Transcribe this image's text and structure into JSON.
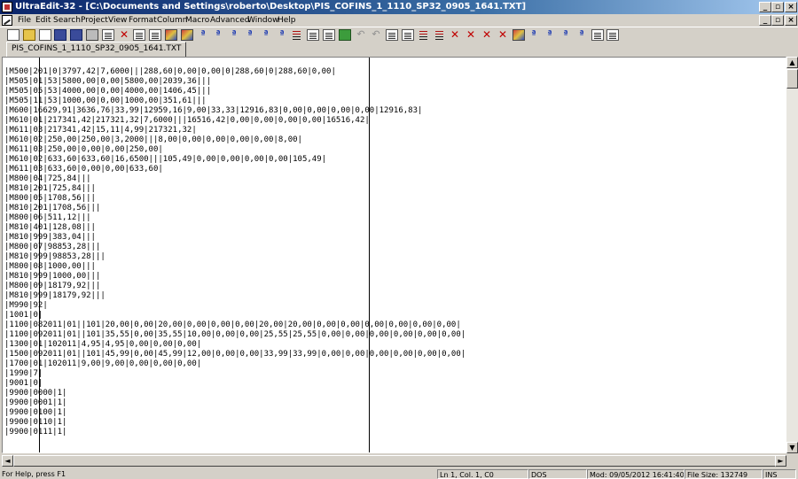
{
  "window": {
    "title": "UltraEdit-32 - [C:\\Documents and Settings\\roberto\\Desktop\\PIS_COFINS_1_1110_SP32_0905_1641.TXT]",
    "min_glyph": "_",
    "max_glyph": "▫",
    "close_glyph": "×",
    "restore_glyph": "▫"
  },
  "menu": [
    "File",
    "Edit",
    "Search",
    "Project",
    "View",
    "Format",
    "Column",
    "Macro",
    "Advanced",
    "Window",
    "Help"
  ],
  "tab": {
    "label": "PIS_COFINS_1_1110_SP32_0905_1641.TXT"
  },
  "toolbar": [
    "new-file-icon",
    "open-file-icon",
    "close-file-icon",
    "save-icon",
    "save-all-icon",
    "print-icon",
    "print-preview-icon",
    "cut-icon",
    "copy-icon",
    "paste-icon",
    "find-icon",
    "replace-icon",
    "unix-to-dos-icon",
    "dos-to-mac-icon",
    "dos-to-unix-icon",
    "uppercase-icon",
    "sort-ascending-icon",
    "sort-descending-icon",
    "column-mode-icon",
    "word-wrap-icon",
    "hex-edit-icon",
    "spell-check-icon",
    "undo-icon",
    "redo-icon",
    "clipboard-icon",
    "paste-special-icon",
    "format-icon",
    "indent-icon",
    "delete-icon",
    "bookmark-icon",
    "close-all-icon",
    "toggle-icon",
    "settings-icon",
    "function-icon",
    "match-brace-icon",
    "find-in-files-icon",
    "replace-in-files-icon",
    "goto-icon",
    "help-icon"
  ],
  "editor": {
    "lines": [
      "|M500|201|0|3797,42|7,6000|||288,60|0,00|0,00|0|288,60|0|288,60|0,00|",
      "|M505|01|53|5800,00|0,00|5800,00|2039,36|||",
      "|M505|05|53|4000,00|0,00|4000,00|1406,45|||",
      "|M505|11|53|1000,00|0,00|1000,00|351,61|||",
      "|M600|16629,91|3636,76|33,99|12959,16|9,00|33,33|12916,83|0,00|0,00|0,00|0,00|12916,83|",
      "|M610|01|217341,42|217321,32|7,6000|||16516,42|0,00|0,00|0,00|0,00|16516,42|",
      "|M611|03|217341,42|15,11|4,99|217321,32|",
      "|M610|02|250,00|250,00|3,2000|||8,00|0,00|0,00|0,00|0,00|8,00|",
      "|M611|03|250,00|0,00|0,00|250,00|",
      "|M610|02|633,60|633,60|16,6500|||105,49|0,00|0,00|0,00|0,00|105,49|",
      "|M611|03|633,60|0,00|0,00|633,60|",
      "|M800|04|725,84|||",
      "|M810|201|725,84|||",
      "|M800|05|1708,56|||",
      "|M810|201|1708,56|||",
      "|M800|06|511,12|||",
      "|M810|401|128,08|||",
      "|M810|999|383,04|||",
      "|M800|07|98853,28|||",
      "|M810|999|98853,28|||",
      "|M800|08|1000,00|||",
      "|M810|999|1000,00|||",
      "|M800|09|18179,92|||",
      "|M810|999|18179,92|||",
      "|M990|92|",
      "|1001|0|",
      "|1100|082011|01||101|20,00|0,00|20,00|0,00|0,00|0,00|20,00|20,00|0,00|0,00|0,00|0,00|0,00|0,00|",
      "|1100|092011|01||101|35,55|0,00|35,55|10,00|0,00|0,00|25,55|25,55|0,00|0,00|0,00|0,00|0,00|0,00|",
      "|1300|01|102011|4,95|4,95|0,00|0,00|0,00|",
      "|1500|092011|01||101|45,99|0,00|45,99|12,00|0,00|0,00|33,99|33,99|0,00|0,00|0,00|0,00|0,00|0,00|",
      "|1700|01|102011|9,00|9,00|0,00|0,00|0,00|",
      "|1990|7|",
      "|9001|0|",
      "|9900|0000|1|",
      "|9900|0001|1|",
      "|9900|0100|1|",
      "|9900|0110|1|",
      "|9900|0111|1|"
    ]
  },
  "scroll": {
    "up": "▲",
    "down": "▼",
    "left": "◄",
    "right": "►"
  },
  "status": {
    "help": "For Help, press F1",
    "position": "Ln 1, Col. 1, C0",
    "format": "DOS",
    "modified": "Mod: 09/05/2012 16:41:40",
    "filesize": "File Size: 132749",
    "mode": "INS"
  }
}
